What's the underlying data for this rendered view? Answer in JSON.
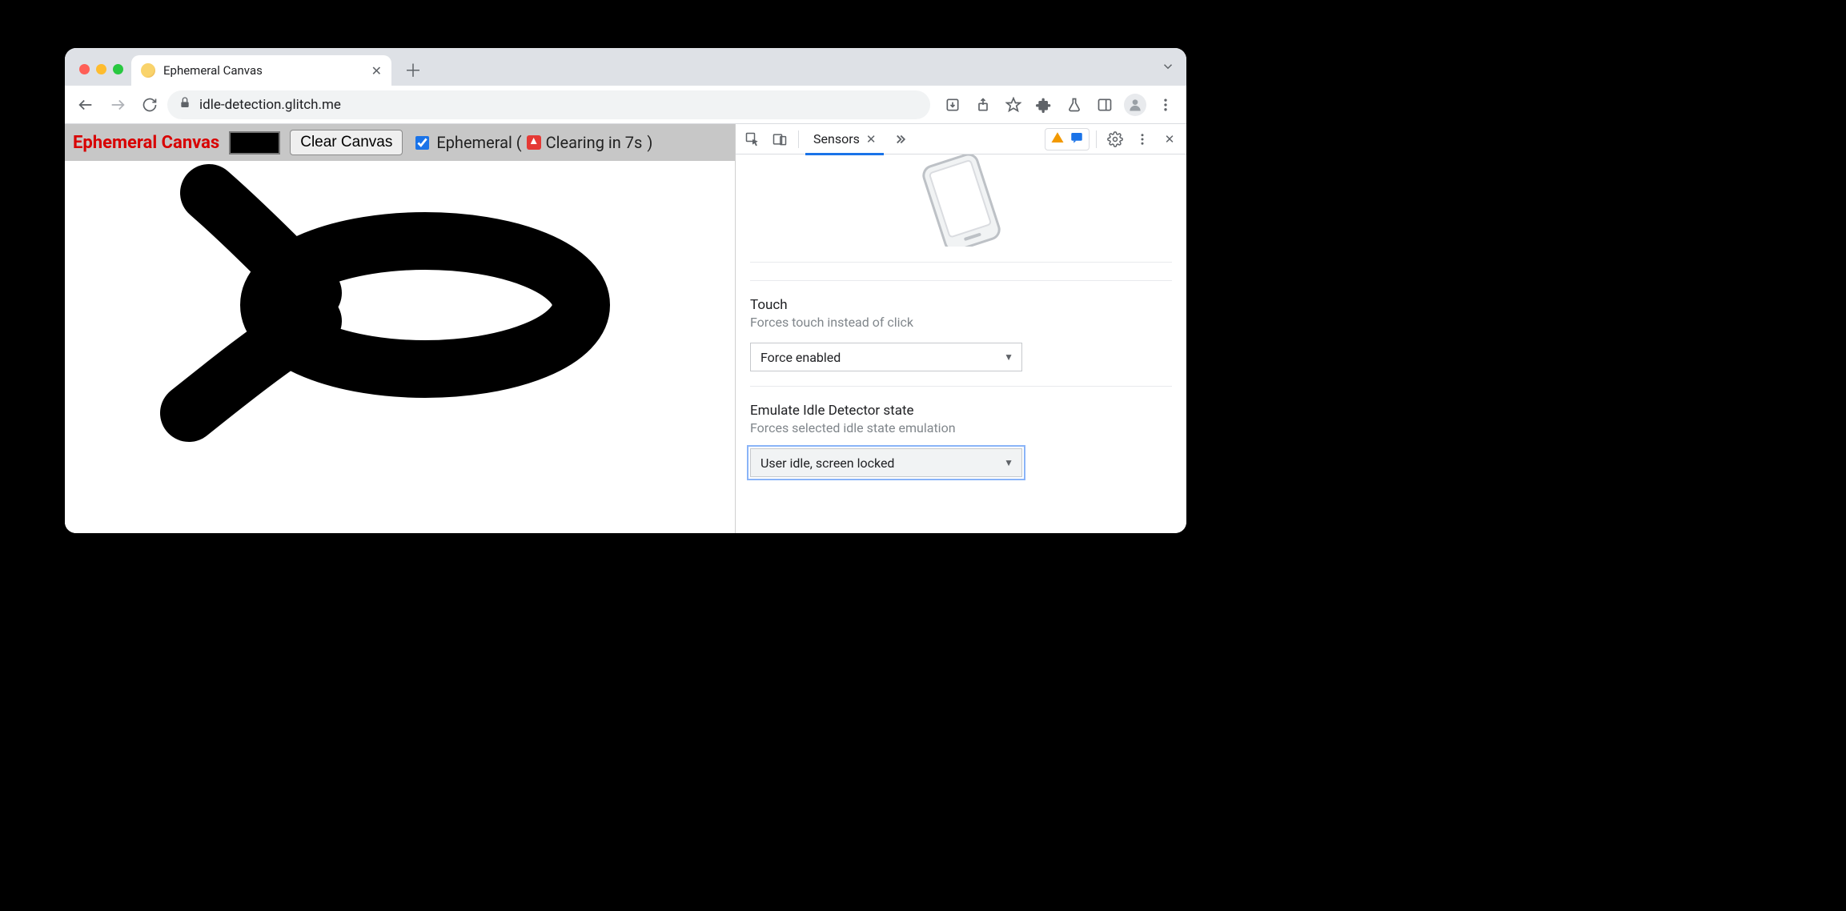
{
  "browser": {
    "tab_title": "Ephemeral Canvas",
    "url": "idle-detection.glitch.me"
  },
  "page": {
    "title": "Ephemeral Canvas",
    "clear_button": "Clear Canvas",
    "ephemeral_checked": true,
    "ephemeral_label_prefix": "Ephemeral (",
    "ephemeral_countdown": "Clearing in 7s",
    "ephemeral_label_suffix": ")",
    "color": "#000000"
  },
  "devtools": {
    "tab": "Sensors",
    "touch": {
      "title": "Touch",
      "desc": "Forces touch instead of click",
      "value": "Force enabled"
    },
    "idle": {
      "title": "Emulate Idle Detector state",
      "desc": "Forces selected idle state emulation",
      "value": "User idle, screen locked"
    }
  }
}
